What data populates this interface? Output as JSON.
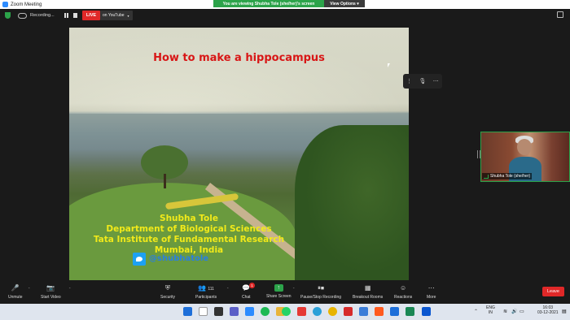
{
  "window": {
    "title": "Zoom Meeting"
  },
  "banner": {
    "message": "You are viewing Shubha Tole (she/her)'s screen",
    "options_label": "View Options"
  },
  "recording": {
    "label": "Recording..."
  },
  "live": {
    "badge": "LIVE",
    "destination": "on YouTube"
  },
  "slide": {
    "title": "How to make a hippocampus",
    "credits": [
      "Shubha Tole",
      "Department of Biological Sciences",
      "Tata Institute of Fundamental Research",
      "Mumbai, India"
    ],
    "twitter_handle": "@shubhatole"
  },
  "participant": {
    "name": "Shubha Tole (she/her)"
  },
  "toolbar": {
    "unmute": "Unmute",
    "start_video": "Start Video",
    "security": "Security",
    "participants": "Participants",
    "participants_count": "111",
    "chat": "Chat",
    "chat_badge": "1",
    "share_screen": "Share Screen",
    "recording": "Pause/Stop Recording",
    "breakout": "Breakout Rooms",
    "reactions": "Reactions",
    "more": "More",
    "leave": "Leave"
  },
  "taskbar": {
    "language_line1": "ENG",
    "language_line2": "IN",
    "time": "16:03",
    "date": "03-12-2021"
  },
  "colors": {
    "accent_green": "#2ca34a",
    "live_red": "#e02828",
    "slide_title_red": "#d81616",
    "credit_yellow": "#f2ea19",
    "twitter_blue": "#1da1f2"
  }
}
